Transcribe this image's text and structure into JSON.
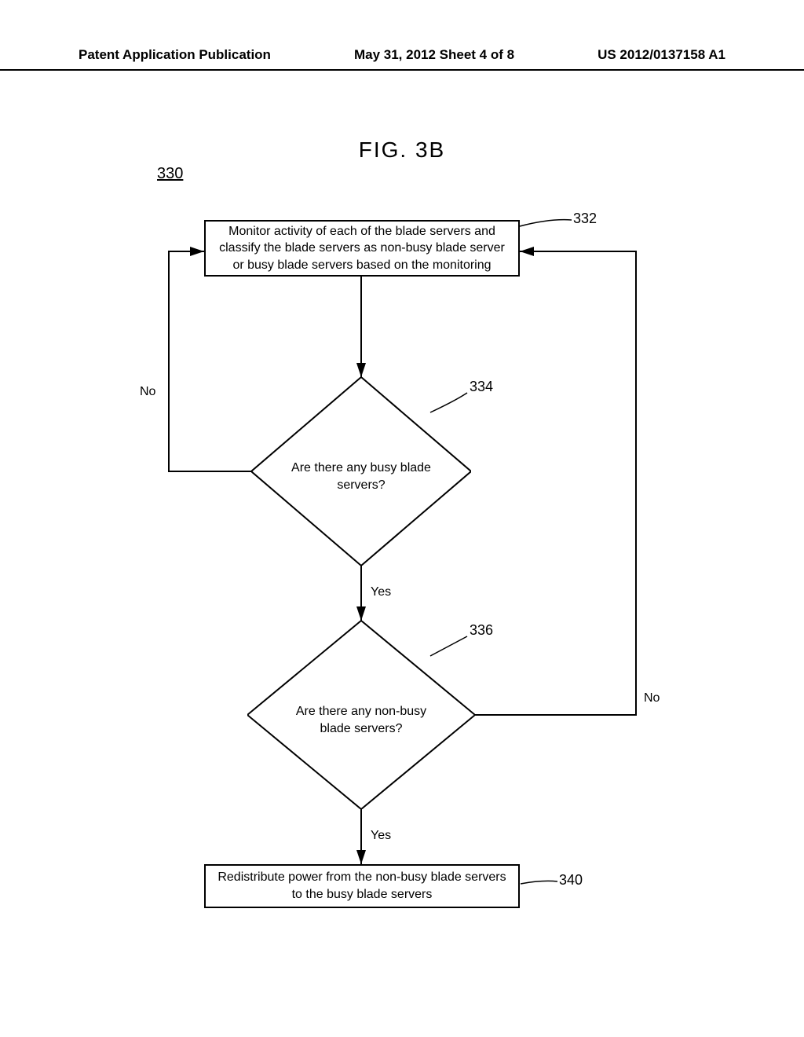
{
  "header": {
    "left": "Patent Application Publication",
    "center": "May 31, 2012  Sheet 4 of 8",
    "right": "US 2012/0137158 A1"
  },
  "figure_title": "FIG. 3B",
  "ref_numbers": {
    "figure": "330",
    "box332": "332",
    "diamond334": "334",
    "diamond336": "336",
    "box340": "340"
  },
  "chart_data": {
    "type": "flowchart",
    "nodes": [
      {
        "id": "332",
        "shape": "rect",
        "text": "Monitor activity of each of the blade servers and classify the blade servers as non-busy blade server or busy blade servers based on the monitoring"
      },
      {
        "id": "334",
        "shape": "diamond",
        "text": "Are there any busy blade servers?"
      },
      {
        "id": "336",
        "shape": "diamond",
        "text": "Are there any non-busy blade servers?"
      },
      {
        "id": "340",
        "shape": "rect",
        "text": "Redistribute power from the non-busy blade servers to the busy blade servers"
      }
    ],
    "edges": [
      {
        "from": "332",
        "to": "334",
        "label": ""
      },
      {
        "from": "334",
        "to": "332",
        "label": "No"
      },
      {
        "from": "334",
        "to": "336",
        "label": "Yes"
      },
      {
        "from": "336",
        "to": "332",
        "label": "No"
      },
      {
        "from": "336",
        "to": "340",
        "label": "Yes"
      }
    ]
  },
  "labels": {
    "no": "No",
    "yes": "Yes"
  }
}
